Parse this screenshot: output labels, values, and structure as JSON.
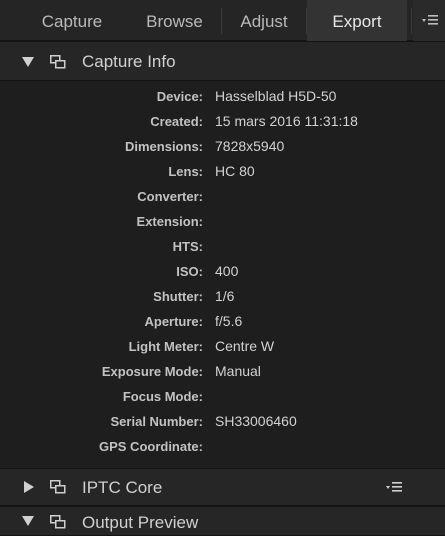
{
  "tabs": [
    {
      "label": "Capture",
      "active": false
    },
    {
      "label": "Browse",
      "active": false
    },
    {
      "label": "Adjust",
      "active": false
    },
    {
      "label": "Export",
      "active": true
    }
  ],
  "sections": {
    "capture_info": {
      "title": "Capture Info",
      "expanded": true
    },
    "iptc_core": {
      "title": "IPTC Core",
      "expanded": false
    },
    "output_preview": {
      "title": "Output Preview",
      "expanded": true
    }
  },
  "capture_info_rows": [
    {
      "label": "Device:",
      "value": "Hasselblad H5D-50"
    },
    {
      "label": "Created:",
      "value": "15 mars 2016 11:31:18"
    },
    {
      "label": "Dimensions:",
      "value": "7828x5940"
    },
    {
      "label": "Lens:",
      "value": "HC 80"
    },
    {
      "label": "Converter:",
      "value": ""
    },
    {
      "label": "Extension:",
      "value": ""
    },
    {
      "label": "HTS:",
      "value": ""
    },
    {
      "label": "ISO:",
      "value": "400"
    },
    {
      "label": "Shutter:",
      "value": "1/6"
    },
    {
      "label": "Aperture:",
      "value": "f/5.6"
    },
    {
      "label": "Light Meter:",
      "value": "Centre W"
    },
    {
      "label": "Exposure Mode:",
      "value": "Manual"
    },
    {
      "label": "Focus Mode:",
      "value": ""
    },
    {
      "label": "Serial Number:",
      "value": "SH33006460"
    },
    {
      "label": "GPS Coordinate:",
      "value": ""
    }
  ],
  "colors": {
    "background": "#1e1e1e",
    "header": "#262626",
    "active_tab": "#333333",
    "text": "#d0d0d0"
  },
  "icons": {
    "tab_menu": "list-menu-icon",
    "section_copy": "copy-icon",
    "section_menu": "list-menu-icon",
    "expand": "disclosure-triangle-icon"
  }
}
